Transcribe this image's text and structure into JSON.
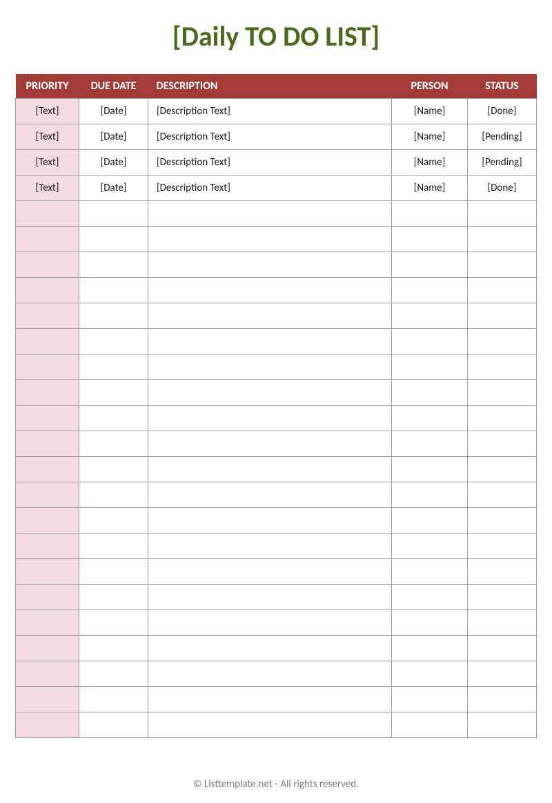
{
  "title": "[Daily TO DO LIST]",
  "headers": {
    "priority": "PRIORITY",
    "duedate": "DUE DATE",
    "description": "DESCRIPTION",
    "person": "PERSON",
    "status": "STATUS"
  },
  "rows": [
    {
      "priority": "[Text]",
      "duedate": "[Date]",
      "description": "[Description Text]",
      "person": "[Name]",
      "status": "[Done]"
    },
    {
      "priority": "[Text]",
      "duedate": "[Date]",
      "description": "[Description Text]",
      "person": "[Name]",
      "status": "[Pending]"
    },
    {
      "priority": "[Text]",
      "duedate": "[Date]",
      "description": "[Description Text]",
      "person": "[Name]",
      "status": "[Pending]"
    },
    {
      "priority": "[Text]",
      "duedate": "[Date]",
      "description": "[Description Text]",
      "person": "[Name]",
      "status": "[Done]"
    },
    {
      "priority": "",
      "duedate": "",
      "description": "",
      "person": "",
      "status": ""
    },
    {
      "priority": "",
      "duedate": "",
      "description": "",
      "person": "",
      "status": ""
    },
    {
      "priority": "",
      "duedate": "",
      "description": "",
      "person": "",
      "status": ""
    },
    {
      "priority": "",
      "duedate": "",
      "description": "",
      "person": "",
      "status": ""
    },
    {
      "priority": "",
      "duedate": "",
      "description": "",
      "person": "",
      "status": ""
    },
    {
      "priority": "",
      "duedate": "",
      "description": "",
      "person": "",
      "status": ""
    },
    {
      "priority": "",
      "duedate": "",
      "description": "",
      "person": "",
      "status": ""
    },
    {
      "priority": "",
      "duedate": "",
      "description": "",
      "person": "",
      "status": ""
    },
    {
      "priority": "",
      "duedate": "",
      "description": "",
      "person": "",
      "status": ""
    },
    {
      "priority": "",
      "duedate": "",
      "description": "",
      "person": "",
      "status": ""
    },
    {
      "priority": "",
      "duedate": "",
      "description": "",
      "person": "",
      "status": ""
    },
    {
      "priority": "",
      "duedate": "",
      "description": "",
      "person": "",
      "status": ""
    },
    {
      "priority": "",
      "duedate": "",
      "description": "",
      "person": "",
      "status": ""
    },
    {
      "priority": "",
      "duedate": "",
      "description": "",
      "person": "",
      "status": ""
    },
    {
      "priority": "",
      "duedate": "",
      "description": "",
      "person": "",
      "status": ""
    },
    {
      "priority": "",
      "duedate": "",
      "description": "",
      "person": "",
      "status": ""
    },
    {
      "priority": "",
      "duedate": "",
      "description": "",
      "person": "",
      "status": ""
    },
    {
      "priority": "",
      "duedate": "",
      "description": "",
      "person": "",
      "status": ""
    },
    {
      "priority": "",
      "duedate": "",
      "description": "",
      "person": "",
      "status": ""
    },
    {
      "priority": "",
      "duedate": "",
      "description": "",
      "person": "",
      "status": ""
    },
    {
      "priority": "",
      "duedate": "",
      "description": "",
      "person": "",
      "status": ""
    }
  ],
  "footer": "© Listtemplate.net - All rights reserved."
}
